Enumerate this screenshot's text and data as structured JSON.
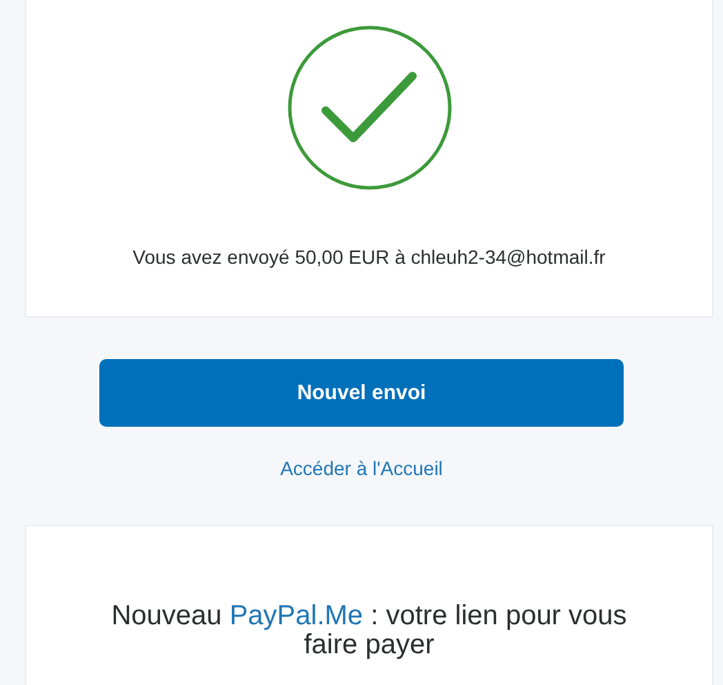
{
  "confirmation": {
    "message": "Vous avez envoyé 50,00 EUR à chleuh2-34@hotmail.fr"
  },
  "primary_button": {
    "label": "Nouvel envoi"
  },
  "home_link": {
    "label": "Accéder à l'Accueil"
  },
  "promo": {
    "title_before": "Nouveau ",
    "title_link": "PayPal.Me",
    "title_after": " : votre lien pour vous faire payer"
  }
}
